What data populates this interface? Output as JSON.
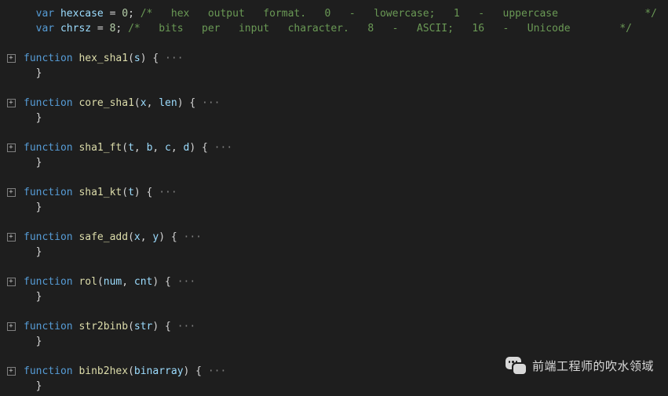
{
  "vars": [
    {
      "name": "hexcase",
      "value": "0",
      "comment": "/*   hex   output   format.   0   -   lowercase;   1   -   uppercase",
      "comment_end": "*/"
    },
    {
      "name": "chrsz",
      "value": "8",
      "comment": "/*   bits   per   input   character.   8   -   ASCII;   16   -   Unicode",
      "comment_end": "*/"
    }
  ],
  "functions": [
    {
      "name": "hex_sha1",
      "params": [
        "s"
      ]
    },
    {
      "name": "core_sha1",
      "params": [
        "x",
        "len"
      ]
    },
    {
      "name": "sha1_ft",
      "params": [
        "t",
        "b",
        "c",
        "d"
      ]
    },
    {
      "name": "sha1_kt",
      "params": [
        "t"
      ]
    },
    {
      "name": "safe_add",
      "params": [
        "x",
        "y"
      ]
    },
    {
      "name": "rol",
      "params": [
        "num",
        "cnt"
      ]
    },
    {
      "name": "str2binb",
      "params": [
        "str"
      ]
    },
    {
      "name": "binb2hex",
      "params": [
        "binarray"
      ]
    }
  ],
  "tokens": {
    "var": "var",
    "function": "function",
    "eq": " = ",
    "semi": ";",
    "open_paren": "(",
    "close_paren": ")",
    "open_brace": " {",
    "close_brace": "}",
    "comma": ", ",
    "ellipsis": " ···",
    "fold_plus": "+"
  },
  "indent": {
    "var_indent": "  ",
    "close_indent": "  "
  },
  "watermark": {
    "text": "前端工程师的吹水领域"
  }
}
